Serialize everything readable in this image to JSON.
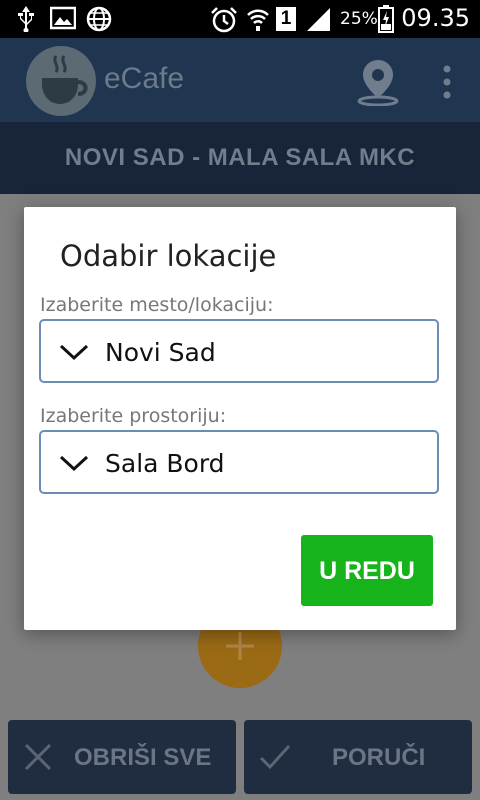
{
  "status_bar": {
    "icons": [
      "usb-icon",
      "image-icon",
      "globe-icon",
      "alarm-icon",
      "wifi-icon",
      "sim-icon",
      "signal-icon",
      "battery-icon"
    ],
    "sim_number": "1",
    "battery_percent": "25%",
    "time": "09.35"
  },
  "app_bar": {
    "title": "eCafe",
    "icons": [
      "coffee-logo-icon",
      "location-pin-icon",
      "more-vert-icon"
    ]
  },
  "location_header": "NOVI SAD - MALA SALA MKC",
  "bottom_bar": {
    "clear_label": "OBRIŠI SVE",
    "order_label": "PORUČI"
  },
  "dialog": {
    "title": "Odabir lokacije",
    "city_label": "Izaberite mesto/lokaciju:",
    "city_value": "Novi Sad",
    "room_label": "Izaberite prostoriju:",
    "room_value": "Sala Bord",
    "ok_label": "U REDU"
  },
  "colors": {
    "ok_button": "#16b31a",
    "select_border": "#6a8db5",
    "app_bar": "#1f3550",
    "fab": "#9a6a15"
  }
}
